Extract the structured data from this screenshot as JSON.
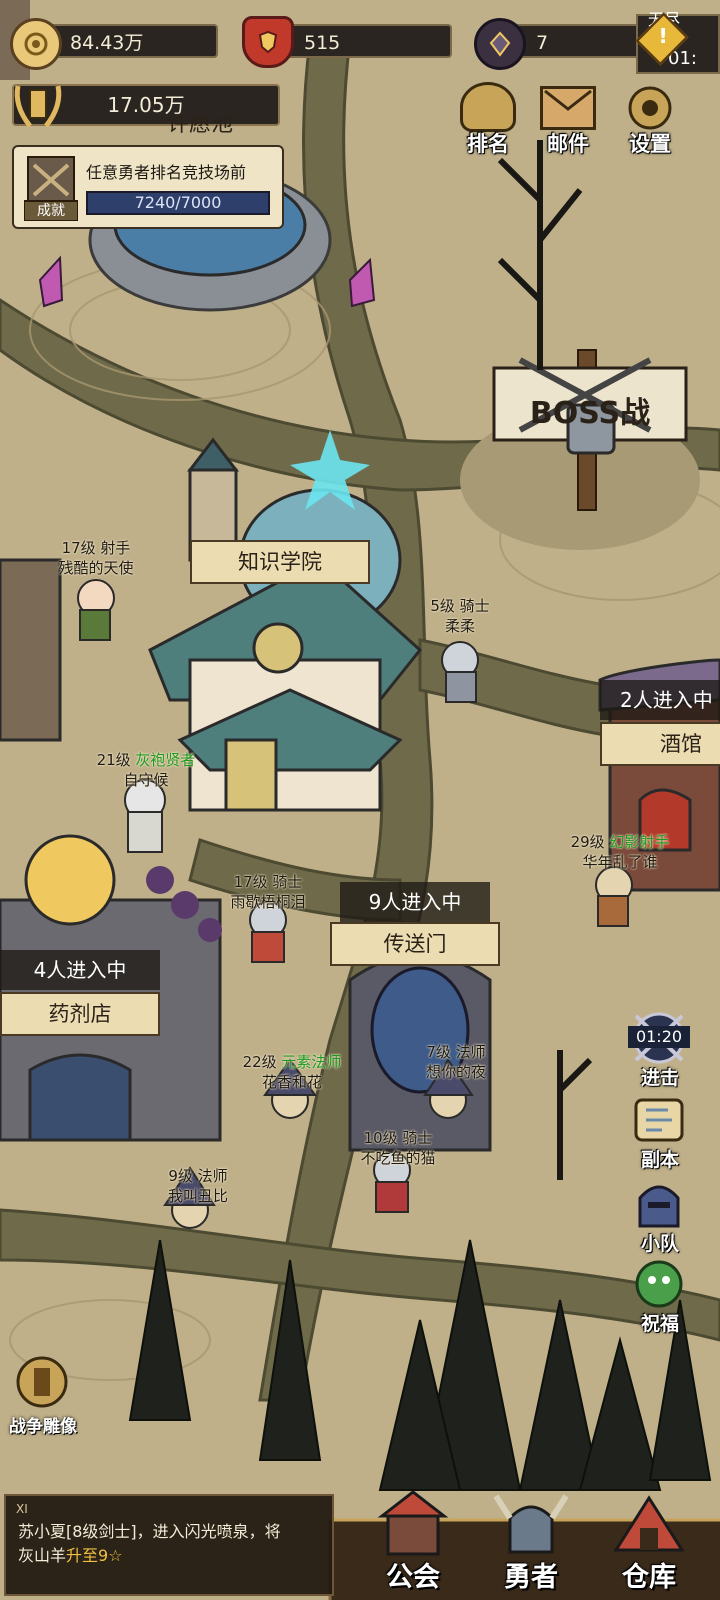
{
  "resources": {
    "gold": {
      "icon": "gold-coin-icon",
      "value": "84.43万"
    },
    "shields": {
      "icon": "red-shield-icon",
      "value": "515"
    },
    "crystals": {
      "icon": "dark-crystal-icon",
      "value": "7"
    }
  },
  "corner": {
    "title_partial": "无尽",
    "timer_partial": "01:"
  },
  "power": {
    "icon": "laurel-crest-icon",
    "value": "17.05万"
  },
  "achievement": {
    "badge": "成就",
    "description": "任意勇者排名竞技场前",
    "progress": "7240/7000",
    "progress_fraction": 1.0
  },
  "top_buttons": [
    {
      "id": "rank",
      "label": "排名",
      "icon": "rank-crown-icon"
    },
    {
      "id": "mail",
      "label": "邮件",
      "icon": "mail-envelope-icon"
    },
    {
      "id": "settings",
      "label": "设置",
      "icon": "gear-icon"
    }
  ],
  "map_labels": {
    "boss_sign": "BOSS战",
    "fountain_partial": "许愿池"
  },
  "buildings": {
    "academy": {
      "name": "知识学院"
    },
    "tavern": {
      "name": "酒馆",
      "occupancy": "2人进入中"
    },
    "portal": {
      "name": "传送门",
      "occupancy": "9人进入中"
    },
    "potion_shop": {
      "name": "药剂店",
      "occupancy": "4人进入中"
    }
  },
  "npcs": [
    {
      "level_class": "17级 射手",
      "special": "",
      "name": "残酷的天使"
    },
    {
      "level_class": "5级 骑士",
      "special": "",
      "name": "柔柔"
    },
    {
      "level_class": "21级 ",
      "special": "灰袍贤者",
      "name": "自守候"
    },
    {
      "level_class": "29级 ",
      "special": "幻影射手",
      "name": "华年乱了谁"
    },
    {
      "level_class": "17级 骑士",
      "special": "",
      "name": "雨歇梧桐泪"
    },
    {
      "level_class": "22级 ",
      "special": "元素法师",
      "name": "花香和花"
    },
    {
      "level_class": "7级 法师",
      "special": "",
      "name": "想你的夜"
    },
    {
      "level_class": "10级 骑士",
      "special": "",
      "name": "不吃鱼的猫"
    },
    {
      "level_class": "9级 法师",
      "special": "",
      "name": "我叫丑比"
    }
  ],
  "side_buttons": [
    {
      "id": "attack",
      "label": "进击",
      "timer": "01:20",
      "icon": "crossed-swords-icon"
    },
    {
      "id": "dungeon",
      "label": "副本",
      "icon": "scroll-map-icon"
    },
    {
      "id": "squad",
      "label": "小队",
      "icon": "knight-helmet-icon"
    },
    {
      "id": "blessing",
      "label": "祝福",
      "icon": "green-spirit-icon"
    }
  ],
  "war_statue": {
    "label": "战争雕像",
    "icon": "statue-crest-icon"
  },
  "news": {
    "tag": "XI",
    "text_1": "苏小夏[8级剑士]，进入闪光喷泉，将",
    "text_2": "灰山羊",
    "highlight": "升至9☆"
  },
  "bottom_nav": [
    {
      "id": "guild",
      "label": "公会",
      "icon": "guild-hall-icon"
    },
    {
      "id": "heroes",
      "label": "勇者",
      "icon": "horned-helmet-icon"
    },
    {
      "id": "warehouse",
      "label": "仓库",
      "icon": "warehouse-tent-icon"
    }
  ],
  "colors": {
    "ground": "#bfb08a",
    "path": "#6f6a4a",
    "banner": "#ecdcb2",
    "accent_gold": "#f0c040",
    "class_green": "#1e9a1e"
  }
}
